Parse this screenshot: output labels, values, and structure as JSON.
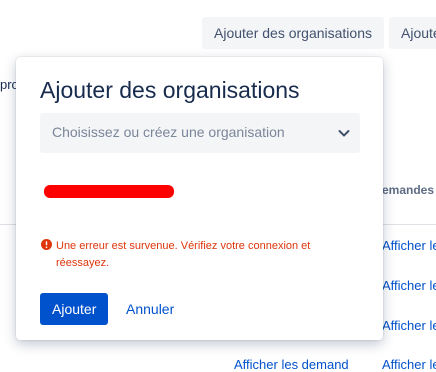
{
  "header": {
    "add_orgs_button": "Ajouter des organisations",
    "add_second_button": "Ajoute"
  },
  "background": {
    "left_fragment": "pro",
    "column_header": "emandes",
    "row_links": [
      "Afficher le",
      "Afficher le",
      "Afficher le",
      "Afficher le"
    ],
    "bottom_link": "Afficher les demand"
  },
  "dialog": {
    "title": "Ajouter des organisations",
    "select": {
      "placeholder": "Choisissez ou créez une organisation",
      "icon": "chevron-down-icon"
    },
    "error": {
      "icon": "error-icon",
      "message": "Une erreur est survenue. Vérifiez votre connexion et réessayez.",
      "color": "#de350b"
    },
    "buttons": {
      "submit": "Ajouter",
      "cancel": "Annuler"
    }
  },
  "colors": {
    "primary": "#0052cc",
    "redaction": "#ff0000"
  }
}
